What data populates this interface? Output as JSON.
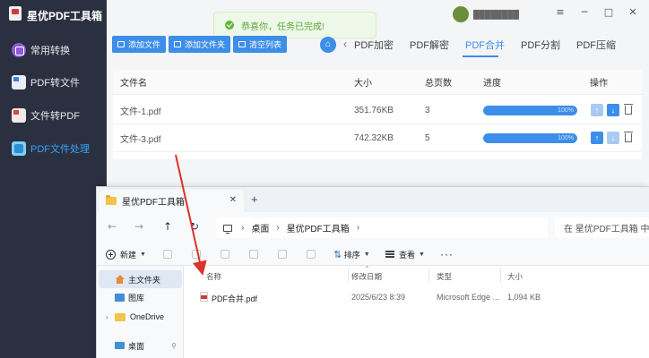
{
  "app": {
    "title": "星优PDF工具箱",
    "user_name": "████████",
    "window_controls": [
      "─",
      "□",
      "✕"
    ],
    "menu_icon": "≡"
  },
  "sidebar": {
    "items": [
      {
        "label": "常用转换",
        "icon": "convert-icon"
      },
      {
        "label": "PDF转文件",
        "icon": "pdf-to-file-icon"
      },
      {
        "label": "文件转PDF",
        "icon": "file-to-pdf-icon"
      },
      {
        "label": "PDF文件处理",
        "icon": "pdf-process-icon",
        "active": true
      }
    ]
  },
  "toast": {
    "message": "恭喜你，任务已完成!"
  },
  "toolbar": {
    "add_file": "添加文件",
    "add_folder": "添加文件夹",
    "clear_list": "清空列表"
  },
  "tabs": {
    "items": [
      "PDF加密",
      "PDF解密",
      "PDF合并",
      "PDF分割",
      "PDF压缩"
    ],
    "active": "PDF合并",
    "prev_arrow": "‹"
  },
  "table": {
    "headers": {
      "name": "文件名",
      "size": "大小",
      "pages": "总页数",
      "progress": "进度",
      "actions": "操作"
    },
    "rows": [
      {
        "name": "文件-1.pdf",
        "size": "351.76KB",
        "pages": "3",
        "progress": 1.0,
        "progress_text": "100%"
      },
      {
        "name": "文件-3.pdf",
        "size": "742.32KB",
        "pages": "5",
        "progress": 1.0,
        "progress_text": "100%"
      }
    ]
  },
  "explorer": {
    "tab_title": "星优PDF工具箱",
    "close": "✕",
    "new_tab": "+",
    "nav": {
      "back": "←",
      "forward": "→",
      "up": "↑",
      "refresh": "↻"
    },
    "breadcrumb": [
      "桌面",
      "星优PDF工具箱"
    ],
    "breadcrumb_sep": "›",
    "search_placeholder": "在 星优PDF工具箱 中搜",
    "commands": {
      "new": "新建",
      "sort": "排序",
      "view": "查看",
      "more": "···"
    },
    "sidebar": [
      {
        "label": "主文件夹",
        "icon": "home-icon",
        "selected": true
      },
      {
        "label": "图库",
        "icon": "gallery-icon"
      },
      {
        "label": "OneDrive",
        "icon": "onedrive-folder-icon"
      },
      {
        "label": "桌面",
        "icon": "desktop-icon"
      }
    ],
    "columns": {
      "name": "名称",
      "modified": "修改日期",
      "type": "类型",
      "size": "大小"
    },
    "files": [
      {
        "name": "PDF合并.pdf",
        "modified": "2025/6/23 8:39",
        "type": "Microsoft Edge ...",
        "size": "1,094 KB"
      }
    ]
  },
  "colors": {
    "sidebar_bg": "#2b3040",
    "accent": "#3d8ee8",
    "active_nav": "#36a3ff",
    "toast_text": "#5aa83a",
    "arrow": "#d9332b"
  }
}
